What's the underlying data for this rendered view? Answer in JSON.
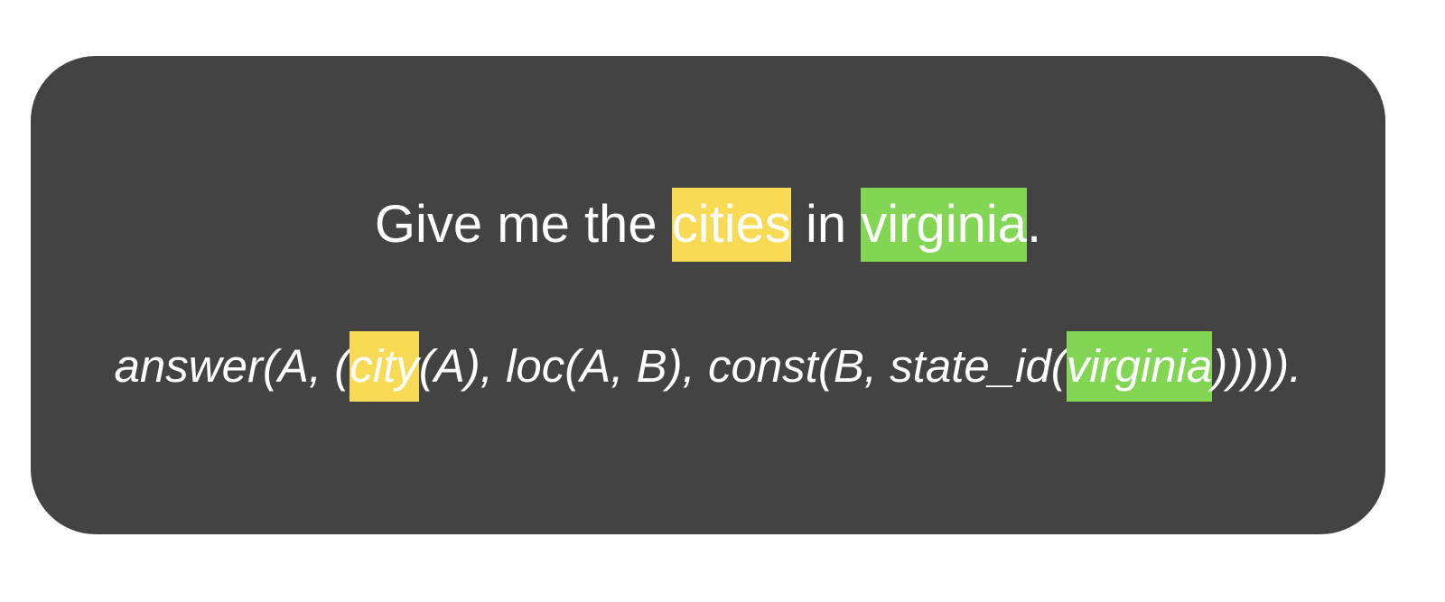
{
  "sentence": {
    "part1": "Give me the ",
    "highlight1": "cities",
    "part2": " in ",
    "highlight2": "virginia",
    "part3": "."
  },
  "logical_form": {
    "part1": "answer(A, (",
    "highlight1": "city",
    "part2": "(A), loc(A, B), const(B, state_id(",
    "highlight2": "virginia",
    "part3": "))))).",
    "_note": ""
  },
  "colors": {
    "panel": "#434343",
    "highlight_yellow": "#f9da54",
    "highlight_green": "#82d654",
    "text": "#ffffff"
  }
}
